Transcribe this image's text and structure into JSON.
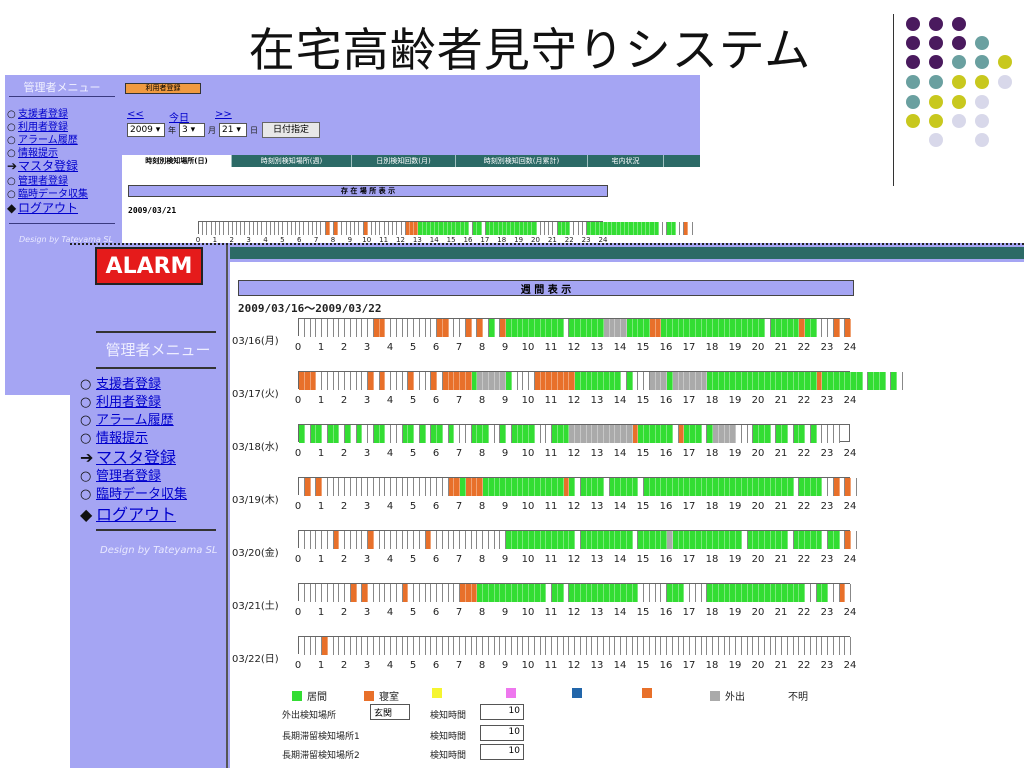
{
  "slide_title": "在宅高齢者見守りシステム",
  "back_window": {
    "menu_title": "管理者メニュー",
    "menu_items": [
      {
        "label": "支援者登録",
        "bullet": "○"
      },
      {
        "label": "利用者登録",
        "bullet": "○"
      },
      {
        "label": "アラーム履歴",
        "bullet": "○"
      },
      {
        "label": "情報提示",
        "bullet": "○"
      },
      {
        "label": "マスタ登録",
        "bullet": "➔"
      },
      {
        "label": "管理者登録",
        "bullet": "○"
      },
      {
        "label": "臨時データ収集",
        "bullet": "○"
      },
      {
        "label": "ログアウト",
        "bullet": "◆"
      }
    ],
    "design_credit": "Design by Tateyama SL",
    "user_register_button": "利用者登録",
    "nav_prev": "<<",
    "nav_today": "今日",
    "nav_next": ">>",
    "year_value": "2009",
    "year_suffix": "年",
    "month_value": "3",
    "month_suffix": "月",
    "day_value": "21",
    "day_suffix": "日",
    "date_button": "日付指定",
    "tabs": [
      "時刻別検知場所(日)",
      "時刻別検知場所(週)",
      "日別検知回数(月)",
      "時刻別検知回数(月累計)",
      "宅内状況"
    ],
    "location_header": "存 在 場 所 表 示",
    "date": "2009/03/21"
  },
  "front_window": {
    "alarm_label": "ALARM",
    "menu_title": "管理者メニュー",
    "menu_items": [
      {
        "label": "支援者登録",
        "bullet": "○"
      },
      {
        "label": "利用者登録",
        "bullet": "○"
      },
      {
        "label": "アラーム履歴",
        "bullet": "○"
      },
      {
        "label": "情報提示",
        "bullet": "○"
      },
      {
        "label": "マスタ登録",
        "bullet": "➔"
      },
      {
        "label": "管理者登録",
        "bullet": "○"
      },
      {
        "label": "臨時データ収集",
        "bullet": "○"
      },
      {
        "label": "ログアウト",
        "bullet": "◆"
      }
    ],
    "design_credit": "Design by Tateyama SL",
    "week_header": "週 間 表 示",
    "week_range": "2009/03/16〜2009/03/22",
    "day_labels": [
      "03/16(月)",
      "03/17(火)",
      "03/18(水)",
      "03/19(木)",
      "03/20(金)",
      "03/21(土)",
      "03/22(日)"
    ],
    "hour_ticks": [
      "0",
      "1",
      "2",
      "3",
      "4",
      "5",
      "6",
      "7",
      "8",
      "9",
      "10",
      "11",
      "12",
      "13",
      "14",
      "15",
      "16",
      "17",
      "18",
      "19",
      "20",
      "21",
      "22",
      "23",
      "24"
    ],
    "legend": [
      {
        "label": "居間",
        "color": "#33dd33"
      },
      {
        "label": "寝室",
        "color": "#e8702a"
      },
      {
        "label": "",
        "color": "#f5f530"
      },
      {
        "label": "",
        "color": "#ee77ee"
      },
      {
        "label": "",
        "color": "#2266aa"
      },
      {
        "label": "",
        "color": "#e8702a"
      },
      {
        "label": "外出",
        "color": "#aaaaaa"
      },
      {
        "label": "不明",
        "color": ""
      }
    ],
    "settings": {
      "outing_label": "外出検知場所",
      "outing_value": "玄関",
      "detect_time_label": "検知時間",
      "outing_time": "10",
      "stay1_label": "長期滞留検知場所1",
      "stay1_time": "10",
      "stay2_label": "長期滞留検知場所2",
      "stay2_time": "10"
    }
  },
  "colors": {
    "living": "#33dd33",
    "bedroom": "#e8702a",
    "out": "#aaaaaa",
    "empty": "#ffffff",
    "panel": "#a5a5f3"
  },
  "chart_data": {
    "type": "table",
    "slots_per_day": 96,
    "legend_codes": {
      "L": "居間",
      "B": "寝室",
      "O": "外出",
      "E": "不明"
    },
    "days": [
      {
        "label": "03/16(月)",
        "runs": [
          [
            "E",
            13
          ],
          [
            "B",
            2
          ],
          [
            "E",
            9
          ],
          [
            "B",
            2
          ],
          [
            "E",
            3
          ],
          [
            "B",
            1
          ],
          [
            "E",
            1
          ],
          [
            "B",
            1
          ],
          [
            "E",
            1
          ],
          [
            "L",
            1
          ],
          [
            "E",
            1
          ],
          [
            "B",
            1
          ],
          [
            "L",
            10
          ],
          [
            "E",
            1
          ],
          [
            "L",
            6
          ],
          [
            "O",
            4
          ],
          [
            "L",
            4
          ],
          [
            "B",
            2
          ],
          [
            "L",
            18
          ],
          [
            "E",
            1
          ],
          [
            "L",
            5
          ],
          [
            "B",
            1
          ],
          [
            "L",
            2
          ],
          [
            "E",
            3
          ],
          [
            "B",
            1
          ],
          [
            "E",
            1
          ],
          [
            "B",
            1
          ]
        ]
      },
      {
        "label": "03/17(火)",
        "runs": [
          [
            "B",
            3
          ],
          [
            "E",
            9
          ],
          [
            "B",
            1
          ],
          [
            "E",
            1
          ],
          [
            "B",
            1
          ],
          [
            "E",
            4
          ],
          [
            "B",
            1
          ],
          [
            "E",
            3
          ],
          [
            "B",
            1
          ],
          [
            "E",
            1
          ],
          [
            "B",
            5
          ],
          [
            "L",
            1
          ],
          [
            "O",
            5
          ],
          [
            "L",
            1
          ],
          [
            "E",
            4
          ],
          [
            "B",
            7
          ],
          [
            "L",
            8
          ],
          [
            "E",
            1
          ],
          [
            "L",
            1
          ],
          [
            "E",
            3
          ],
          [
            "O",
            3
          ],
          [
            "L",
            1
          ],
          [
            "O",
            6
          ],
          [
            "L",
            19
          ],
          [
            "B",
            1
          ],
          [
            "L",
            7
          ],
          [
            "E",
            1
          ],
          [
            "L",
            3
          ],
          [
            "E",
            1
          ],
          [
            "L",
            1
          ],
          [
            "E",
            1
          ]
        ]
      },
      {
        "label": "03/18(水)",
        "runs": [
          [
            "L",
            1
          ],
          [
            "E",
            1
          ],
          [
            "L",
            2
          ],
          [
            "E",
            1
          ],
          [
            "L",
            2
          ],
          [
            "E",
            1
          ],
          [
            "L",
            1
          ],
          [
            "E",
            1
          ],
          [
            "L",
            1
          ],
          [
            "E",
            2
          ],
          [
            "L",
            2
          ],
          [
            "E",
            3
          ],
          [
            "L",
            2
          ],
          [
            "E",
            1
          ],
          [
            "L",
            1
          ],
          [
            "E",
            1
          ],
          [
            "L",
            2
          ],
          [
            "E",
            1
          ],
          [
            "L",
            1
          ],
          [
            "E",
            3
          ],
          [
            "L",
            3
          ],
          [
            "E",
            2
          ],
          [
            "L",
            1
          ],
          [
            "E",
            1
          ],
          [
            "L",
            4
          ],
          [
            "E",
            3
          ],
          [
            "L",
            3
          ],
          [
            "O",
            11
          ],
          [
            "B",
            1
          ],
          [
            "L",
            6
          ],
          [
            "E",
            1
          ],
          [
            "B",
            1
          ],
          [
            "L",
            3
          ],
          [
            "E",
            1
          ],
          [
            "L",
            1
          ],
          [
            "O",
            4
          ],
          [
            "E",
            3
          ],
          [
            "L",
            3
          ],
          [
            "E",
            1
          ],
          [
            "L",
            2
          ],
          [
            "E",
            1
          ],
          [
            "L",
            2
          ],
          [
            "E",
            1
          ],
          [
            "L",
            1
          ],
          [
            "E",
            4
          ]
        ]
      },
      {
        "label": "03/19(木)",
        "runs": [
          [
            "E",
            1
          ],
          [
            "B",
            1
          ],
          [
            "E",
            1
          ],
          [
            "B",
            1
          ],
          [
            "E",
            22
          ],
          [
            "B",
            2
          ],
          [
            "L",
            1
          ],
          [
            "B",
            3
          ],
          [
            "L",
            14
          ],
          [
            "B",
            1
          ],
          [
            "L",
            1
          ],
          [
            "E",
            1
          ],
          [
            "L",
            4
          ],
          [
            "E",
            1
          ],
          [
            "L",
            5
          ],
          [
            "E",
            1
          ],
          [
            "L",
            26
          ],
          [
            "E",
            1
          ],
          [
            "L",
            4
          ],
          [
            "E",
            2
          ],
          [
            "B",
            1
          ],
          [
            "E",
            1
          ],
          [
            "B",
            1
          ],
          [
            "E",
            1
          ]
        ]
      },
      {
        "label": "03/20(金)",
        "runs": [
          [
            "E",
            6
          ],
          [
            "B",
            1
          ],
          [
            "E",
            5
          ],
          [
            "B",
            1
          ],
          [
            "E",
            9
          ],
          [
            "B",
            1
          ],
          [
            "E",
            13
          ],
          [
            "L",
            12
          ],
          [
            "E",
            1
          ],
          [
            "L",
            9
          ],
          [
            "E",
            1
          ],
          [
            "L",
            5
          ],
          [
            "O",
            1
          ],
          [
            "L",
            12
          ],
          [
            "E",
            1
          ],
          [
            "L",
            7
          ],
          [
            "E",
            1
          ],
          [
            "L",
            5
          ],
          [
            "E",
            1
          ],
          [
            "L",
            2
          ],
          [
            "E",
            1
          ],
          [
            "B",
            1
          ],
          [
            "E",
            1
          ]
        ]
      },
      {
        "label": "03/21(土)",
        "runs": [
          [
            "E",
            9
          ],
          [
            "B",
            1
          ],
          [
            "E",
            1
          ],
          [
            "B",
            1
          ],
          [
            "E",
            6
          ],
          [
            "B",
            1
          ],
          [
            "E",
            9
          ],
          [
            "B",
            3
          ],
          [
            "L",
            12
          ],
          [
            "E",
            1
          ],
          [
            "L",
            2
          ],
          [
            "E",
            1
          ],
          [
            "L",
            12
          ],
          [
            "E",
            5
          ],
          [
            "L",
            3
          ],
          [
            "E",
            4
          ],
          [
            "L",
            17
          ],
          [
            "E",
            2
          ],
          [
            "L",
            2
          ],
          [
            "E",
            2
          ],
          [
            "B",
            1
          ],
          [
            "E",
            1
          ]
        ]
      },
      {
        "label": "03/22(日)",
        "runs": [
          [
            "E",
            4
          ],
          [
            "B",
            1
          ],
          [
            "E",
            91
          ]
        ]
      }
    ],
    "back_day": {
      "label": "2009/03/21",
      "runs": [
        [
          "E",
          30
        ],
        [
          "B",
          1
        ],
        [
          "E",
          1
        ],
        [
          "B",
          1
        ],
        [
          "E",
          6
        ],
        [
          "B",
          1
        ],
        [
          "E",
          9
        ],
        [
          "B",
          3
        ],
        [
          "L",
          12
        ],
        [
          "E",
          1
        ],
        [
          "L",
          2
        ],
        [
          "E",
          1
        ],
        [
          "L",
          12
        ],
        [
          "E",
          5
        ],
        [
          "L",
          3
        ],
        [
          "E",
          4
        ],
        [
          "L",
          17
        ],
        [
          "E",
          2
        ],
        [
          "L",
          2
        ],
        [
          "E",
          2
        ],
        [
          "B",
          1
        ],
        [
          "E",
          1
        ]
      ]
    }
  }
}
